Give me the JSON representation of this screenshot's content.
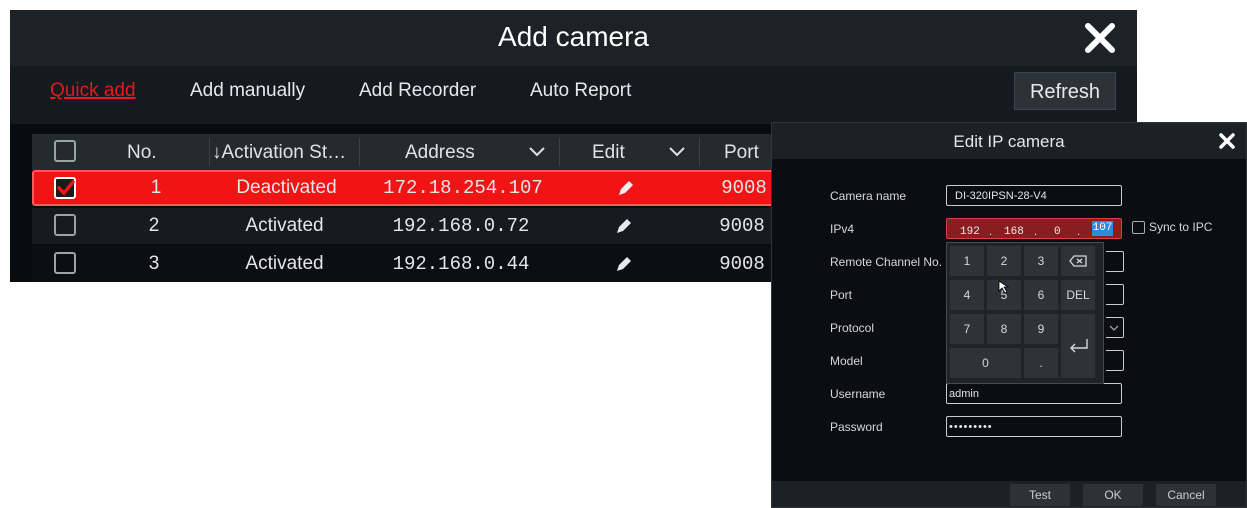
{
  "add_camera": {
    "title": "Add camera",
    "tabs": [
      "Quick add",
      "Add manually",
      "Add Recorder",
      "Auto Report"
    ],
    "refresh_label": "Refresh",
    "columns": {
      "no": "No.",
      "activation": "↓Activation St…",
      "address": "Address",
      "edit": "Edit",
      "port": "Port"
    },
    "rows": [
      {
        "checked": true,
        "no": "1",
        "status": "Deactivated",
        "address": "172.18.254.107",
        "port": "9008"
      },
      {
        "checked": false,
        "no": "2",
        "status": "Activated",
        "address": "192.168.0.72",
        "port": "9008"
      },
      {
        "checked": false,
        "no": "3",
        "status": "Activated",
        "address": "192.168.0.44",
        "port": "9008"
      }
    ]
  },
  "edit_ip_camera": {
    "title": "Edit IP camera",
    "labels": {
      "camera_name": "Camera name",
      "ipv4": "IPv4",
      "remote_channel": "Remote Channel No.",
      "port": "Port",
      "protocol": "Protocol",
      "model": "Model",
      "username": "Username",
      "password": "Password"
    },
    "camera_name_value": "DI-320IPSN-28-V4",
    "ipv4": {
      "seg1": "192",
      "seg2": "168",
      "seg3": "0",
      "seg4": "107"
    },
    "sync_label": "Sync to IPC",
    "username_value": "admin",
    "password_value": "•••••••••",
    "keypad": {
      "k1": "1",
      "k2": "2",
      "k3": "3",
      "k4": "4",
      "k5": "5",
      "k6": "6",
      "k7": "7",
      "k8": "8",
      "k9": "9",
      "k0": "0",
      "dot": ".",
      "del": "DEL"
    },
    "buttons": {
      "test": "Test",
      "ok": "OK",
      "cancel": "Cancel"
    }
  },
  "colors": {
    "accent_red": "#f01414",
    "selection_blue": "#2d8ae0",
    "background": "#080b0f"
  }
}
